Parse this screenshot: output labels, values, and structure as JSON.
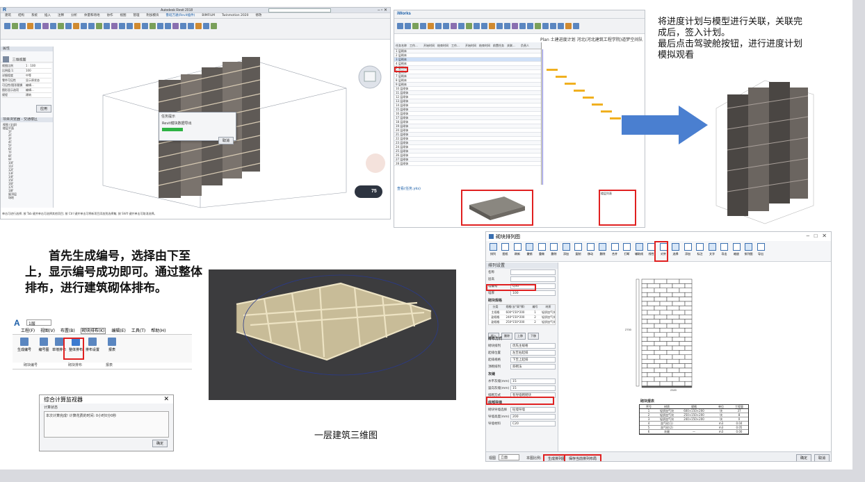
{
  "revit": {
    "title": "Autodesk Revit 2018",
    "menu": [
      "建筑",
      "结构",
      "系统",
      "插入",
      "注释",
      "分析",
      "体量和场地",
      "协作",
      "视图",
      "管理",
      "附加模块",
      "鲁班万通(Revit插件)",
      "BIMFILM",
      "Twinmotion 2020",
      "修改"
    ],
    "properties_title": "属性",
    "view_type": "三维视图",
    "props": [
      [
        "视图比例",
        "1 : 100"
      ],
      [
        "比例值 1:",
        "100"
      ],
      [
        "详细程度",
        "中等"
      ],
      [
        "零件可见性",
        "显示原状态"
      ],
      [
        "可见性/图形替换",
        "编辑..."
      ],
      [
        "图形显示选项",
        "编辑..."
      ],
      [
        "规程",
        "建筑"
      ]
    ],
    "apply": "应用",
    "browser_title": "项目浏览器 - 交通楼区",
    "browser_items": [
      "视图 (全部)",
      "楼层平面",
      "1F",
      "2F",
      "3F",
      "4F",
      "5F",
      "6F",
      "7F",
      "8F",
      "9F",
      "10F",
      "11F",
      "12F",
      "13F",
      "14F",
      "15F",
      "16F",
      "17F",
      "18F",
      "屋顶层",
      "场地"
    ],
    "dialog_title": "任务提示",
    "dialog_text": "Revit模块数据导出",
    "dialog_cancel": "取消",
    "status": "单击可进行选择; 按 Tab 键并单击可选择其他项目; 按 Ctrl 键并单击可将新项目添加到选择集; 按 Shift 键并单击可取消选择。",
    "fps": "75"
  },
  "iworks": {
    "logo": "iWorks",
    "plan_title": "Plan 土建进度计划 河北(河北建筑工程学院)道梦空间队",
    "columns": [
      "任务名称",
      "工作...",
      "开始时间",
      "结束时间",
      "工作...",
      "开始时间",
      "结束时间",
      "前置任务",
      "关联...",
      "负责人"
    ],
    "rows": [
      "1 层砌体",
      "2 层砌体",
      "3 层砌体",
      "4 层砌体",
      "5 层砌体",
      "6 层砌体",
      "7 层砌体",
      "8 层砌体",
      "9 层砌体",
      "10 层砌体",
      "11 层砌体",
      "12 层砌体",
      "13 层砌体",
      "14 层砌体",
      "15 层砌体",
      "16 层砌体",
      "17 层砌体",
      "18 层砌体",
      "19 层砌体",
      "20 层砌体",
      "21 层砌体",
      "22 层砌体",
      "23 层砌体",
      "24 层砌体",
      "25 层砌体",
      "26 层砌体",
      "27 层砌体",
      "28 层砌体"
    ],
    "plan_link": "查看(任务.yks)",
    "tree_title": "楼层列表"
  },
  "desc_right": [
    "将进度计划与模型进行关联，关联完",
    "成后，签入计划。",
    "最后点击驾驶舱按钮，进行进度计划",
    "模拟观看"
  ],
  "main_desc": "首先生成编号，选择由下至上，显示编号成功即可。通过整体排布，进行建筑砌体排布。",
  "ribbon_small": {
    "floor": "1层",
    "menu": [
      "工程(F)",
      "视图(V)",
      "布置(B)",
      "砌块排布(K)",
      "编辑(E)",
      "工具(T)",
      "帮助(H)"
    ],
    "buttons": [
      "生成编号",
      "编号图",
      "单墙排布",
      "整体排布",
      "排布设置",
      "报表"
    ],
    "groups": [
      "砌块编号",
      "砌块排布",
      "报表"
    ]
  },
  "monitor": {
    "title": "综合计算监视器",
    "label": "计算状态",
    "text": "本次计算完成! 计算花费的时间: 0小时0分0秒",
    "ok": "确定"
  },
  "caption": "一层建筑三维图",
  "block": {
    "window_title": "砌块排列图",
    "toolbar": [
      "排列",
      "图纸",
      "刷新",
      "撤销",
      "重做",
      "删除",
      "添加",
      "复制",
      "移动",
      "删除",
      "合并",
      "打断",
      "辅助线",
      "线性",
      "对齐",
      "选择",
      "添加",
      "标注",
      "文字",
      "导出",
      "缩放",
      "排列图",
      "导出"
    ],
    "settings_title": "排列设置",
    "fields": [
      [
        "名称",
        ""
      ],
      [
        "层高",
        ""
      ],
      [
        "墙编号",
        "Q30"
      ],
      [
        "墙厚",
        "100"
      ]
    ],
    "block_title": "砌块规格",
    "table_head": [
      "分类",
      "规格(长*高*厚)",
      "编号",
      "材质"
    ],
    "table_rows": [
      [
        "主规格",
        "600*150*200",
        "1",
        "轻质加气块"
      ],
      [
        "副规格",
        "240*150*200",
        "2",
        "轻质加气块"
      ],
      [
        "副规格",
        "250*150*200",
        "2",
        "轻质加气块"
      ]
    ],
    "btns": [
      "插入",
      "删除",
      "上移",
      "下移"
    ],
    "arrange_title": "排布方式",
    "arrange": [
      [
        "砌块排列",
        "优先主规格"
      ],
      [
        "起排位置",
        "左至右起排"
      ],
      [
        "起排规格",
        "下至上起排"
      ],
      [
        "顶砌排列",
        "斜砌法"
      ]
    ],
    "gray_title": "灰缝",
    "gray": [
      [
        "水平灰缝(mm)",
        "15"
      ],
      [
        "竖向灰缝(mm)",
        "15"
      ],
      [
        "排砌方式",
        "有导墙砌砌块"
      ]
    ],
    "bottom_title": "底部导墙",
    "bottom": [
      [
        "砌块导墙选择",
        "砼墙导墙"
      ],
      [
        "导墙高度(mm)",
        "200"
      ],
      [
        "导墙材料",
        "C20"
      ]
    ],
    "view_label": "视图",
    "view_value": "立面",
    "ratio": "本图比例:",
    "gen_btn": "生成排列图",
    "save_btn": "保存当前排列布局",
    "ok": "确定",
    "cancel": "取消",
    "dims": [
      "2320",
      "1800",
      "2700"
    ],
    "schedule_title": "砌块报表",
    "schedule_head": [
      "序号",
      "材质",
      "规格",
      "单位",
      "工程量"
    ],
    "schedule_rows": [
      [
        "1",
        "轻质加气块",
        "600×150×200",
        "块",
        "37"
      ],
      [
        "2",
        "轻质加气块",
        "250×150×200",
        "块",
        "8"
      ],
      [
        "3",
        "轻质加气块",
        "240×150×200",
        "块",
        "0"
      ],
      [
        "4",
        "加气砼(1)",
        "",
        " m3",
        "0.04"
      ],
      [
        "5",
        "加气砼(2)",
        "",
        " m3",
        "0.05"
      ],
      [
        "6",
        "灰缝",
        "—",
        "m3",
        "0.00"
      ]
    ]
  }
}
